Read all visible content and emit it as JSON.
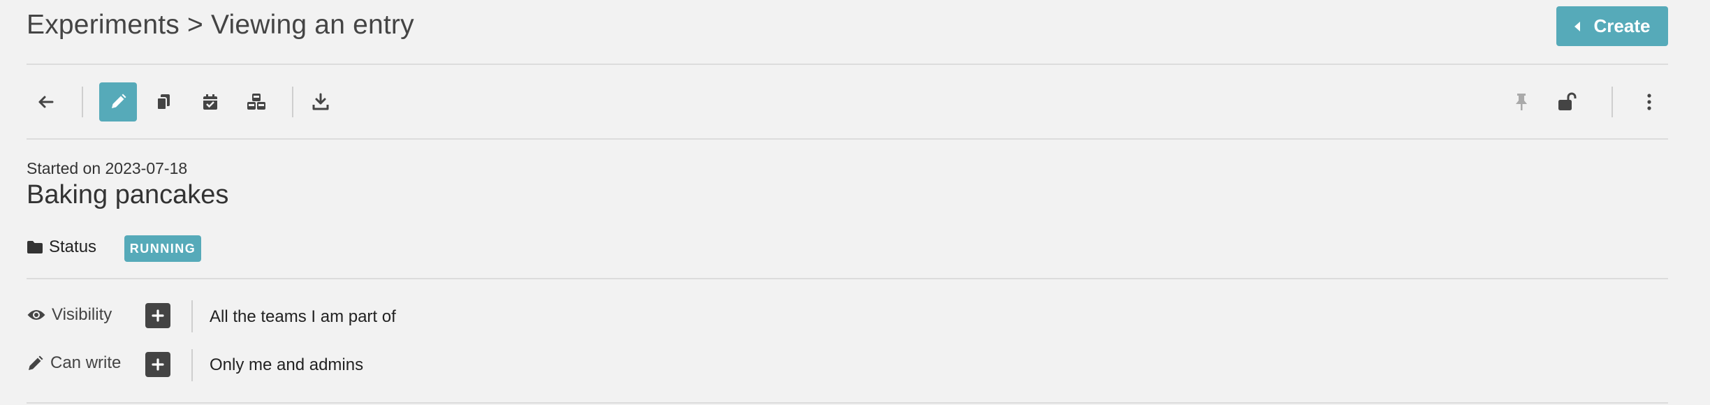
{
  "header": {
    "breadcrumb": "Experiments > Viewing an entry",
    "create_label": "Create"
  },
  "toolbar": {
    "icons": [
      "back-arrow-icon",
      "edit-icon",
      "duplicate-icon",
      "calendar-check-icon",
      "cubes-icon",
      "download-icon",
      "pin-icon",
      "unlock-icon",
      "kebab-menu-icon"
    ],
    "active": "edit-icon",
    "accent": "#56aab9"
  },
  "entry": {
    "started": "Started on 2023-07-18",
    "title": "Baking pancakes",
    "status_label": "Status",
    "status_value": "RUNNING",
    "status_color": "#56aab9"
  },
  "permissions": {
    "visibility_label": "Visibility",
    "visibility_value": "All the teams I am part of",
    "canwrite_label": "Can write",
    "canwrite_value": "Only me and admins"
  }
}
